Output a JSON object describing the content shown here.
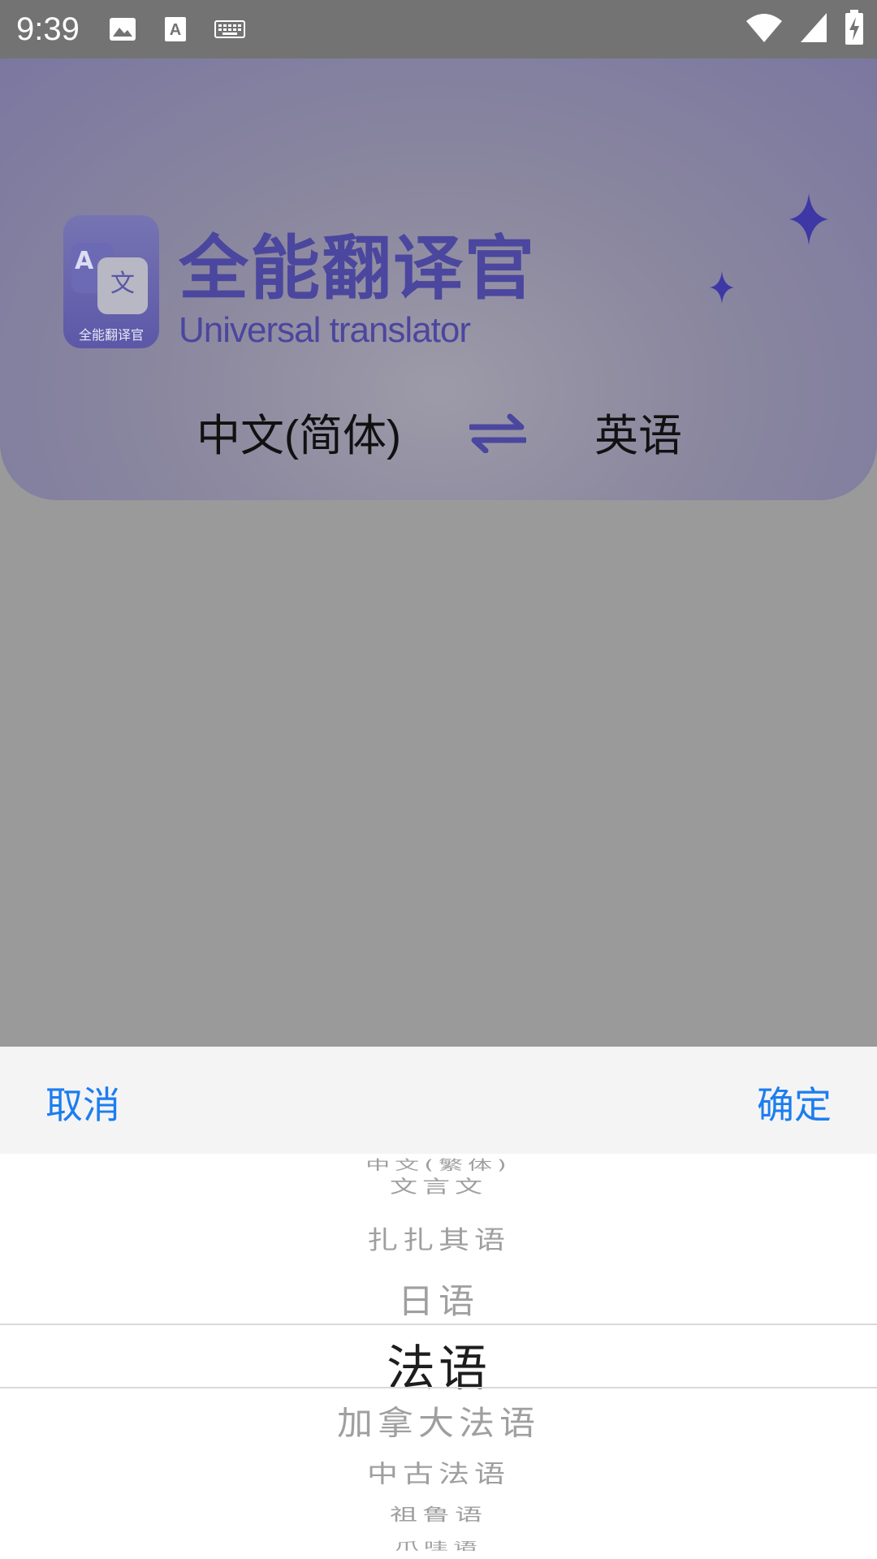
{
  "status_bar": {
    "time": "9:39",
    "icons_left": [
      "image-icon",
      "text-a-icon",
      "keyboard-icon"
    ],
    "icons_right": [
      "wifi-icon",
      "cell-signal-icon",
      "battery-charging-icon"
    ]
  },
  "header": {
    "logo": {
      "letter_a": "A",
      "glyph": "文",
      "caption": "全能翻译官"
    },
    "title_cn": "全能翻译官",
    "title_en": "Universal translator",
    "source_language": "中文(简体)",
    "swap_icon": "swap-arrows-icon",
    "target_language": "英语"
  },
  "picker": {
    "cancel_label": "取消",
    "confirm_label": "确定",
    "items": [
      "中文(繁体)",
      "文言文",
      "扎扎其语",
      "日语",
      "法语",
      "加拿大法语",
      "中古法语",
      "祖鲁语",
      "爪哇语"
    ],
    "selected": "法语"
  },
  "colors": {
    "accent_blue": "#1c7df0",
    "brand_purple": "#4b469e",
    "overlay_gray": "#9a9a9a"
  }
}
